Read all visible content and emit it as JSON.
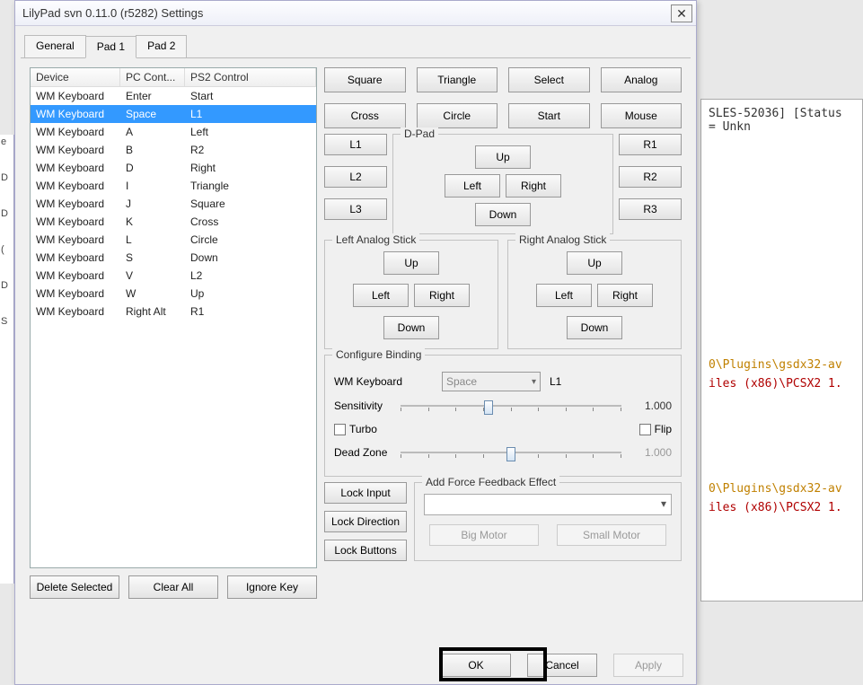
{
  "bg": {
    "line1": "SLES-52036] [Status = Unkn",
    "y1": "0\\Plugins\\gsdx32-av",
    "r1": "iles (x86)\\PCSX2 1.",
    "y2": "0\\Plugins\\gsdx32-av",
    "r2": "iles (x86)\\PCSX2 1."
  },
  "title": "LilyPad svn 0.11.0 (r5282) Settings",
  "tabs": {
    "general": "General",
    "pad1": "Pad 1",
    "pad2": "Pad 2"
  },
  "list": {
    "headers": {
      "device": "Device",
      "pc": "PC Cont...",
      "ps2": "PS2 Control"
    },
    "rows": [
      {
        "d": "WM Keyboard",
        "p": "Enter",
        "s": "Start",
        "sel": false
      },
      {
        "d": "WM Keyboard",
        "p": "Space",
        "s": "L1",
        "sel": true
      },
      {
        "d": "WM Keyboard",
        "p": "A",
        "s": "Left",
        "sel": false
      },
      {
        "d": "WM Keyboard",
        "p": "B",
        "s": "R2",
        "sel": false
      },
      {
        "d": "WM Keyboard",
        "p": "D",
        "s": "Right",
        "sel": false
      },
      {
        "d": "WM Keyboard",
        "p": "I",
        "s": "Triangle",
        "sel": false
      },
      {
        "d": "WM Keyboard",
        "p": "J",
        "s": "Square",
        "sel": false
      },
      {
        "d": "WM Keyboard",
        "p": "K",
        "s": "Cross",
        "sel": false
      },
      {
        "d": "WM Keyboard",
        "p": "L",
        "s": "Circle",
        "sel": false
      },
      {
        "d": "WM Keyboard",
        "p": "S",
        "s": "Down",
        "sel": false
      },
      {
        "d": "WM Keyboard",
        "p": "V",
        "s": "L2",
        "sel": false
      },
      {
        "d": "WM Keyboard",
        "p": "W",
        "s": "Up",
        "sel": false
      },
      {
        "d": "WM Keyboard",
        "p": "Right Alt",
        "s": "R1",
        "sel": false
      }
    ]
  },
  "leftbtns": {
    "delete": "Delete Selected",
    "clear": "Clear All",
    "ignore": "Ignore Key"
  },
  "pad": {
    "square": "Square",
    "triangle": "Triangle",
    "select": "Select",
    "analog": "Analog",
    "cross": "Cross",
    "circle": "Circle",
    "start": "Start",
    "mouse": "Mouse",
    "l1": "L1",
    "l2": "L2",
    "l3": "L3",
    "r1": "R1",
    "r2": "R2",
    "r3": "R3",
    "dpad": {
      "legend": "D-Pad",
      "up": "Up",
      "down": "Down",
      "left": "Left",
      "right": "Right"
    },
    "lstick": {
      "legend": "Left Analog Stick",
      "up": "Up",
      "down": "Down",
      "left": "Left",
      "right": "Right"
    },
    "rstick": {
      "legend": "Right Analog Stick",
      "up": "Up",
      "down": "Down",
      "left": "Left",
      "right": "Right"
    }
  },
  "cfg": {
    "legend": "Configure Binding",
    "device": "WM Keyboard",
    "combo": "Space",
    "bind": "L1",
    "sens_label": "Sensitivity",
    "sens_val": "1.000",
    "turbo": "Turbo",
    "flip": "Flip",
    "dz_label": "Dead Zone",
    "dz_val": "1.000"
  },
  "lock": {
    "input": "Lock Input",
    "direction": "Lock Direction",
    "buttons": "Lock Buttons"
  },
  "ff": {
    "legend": "Add Force Feedback Effect",
    "big": "Big Motor",
    "small": "Small Motor"
  },
  "footer": {
    "ok": "OK",
    "cancel": "Cancel",
    "apply": "Apply"
  },
  "side": [
    "e",
    "D",
    "D",
    "(",
    "D",
    "S"
  ]
}
